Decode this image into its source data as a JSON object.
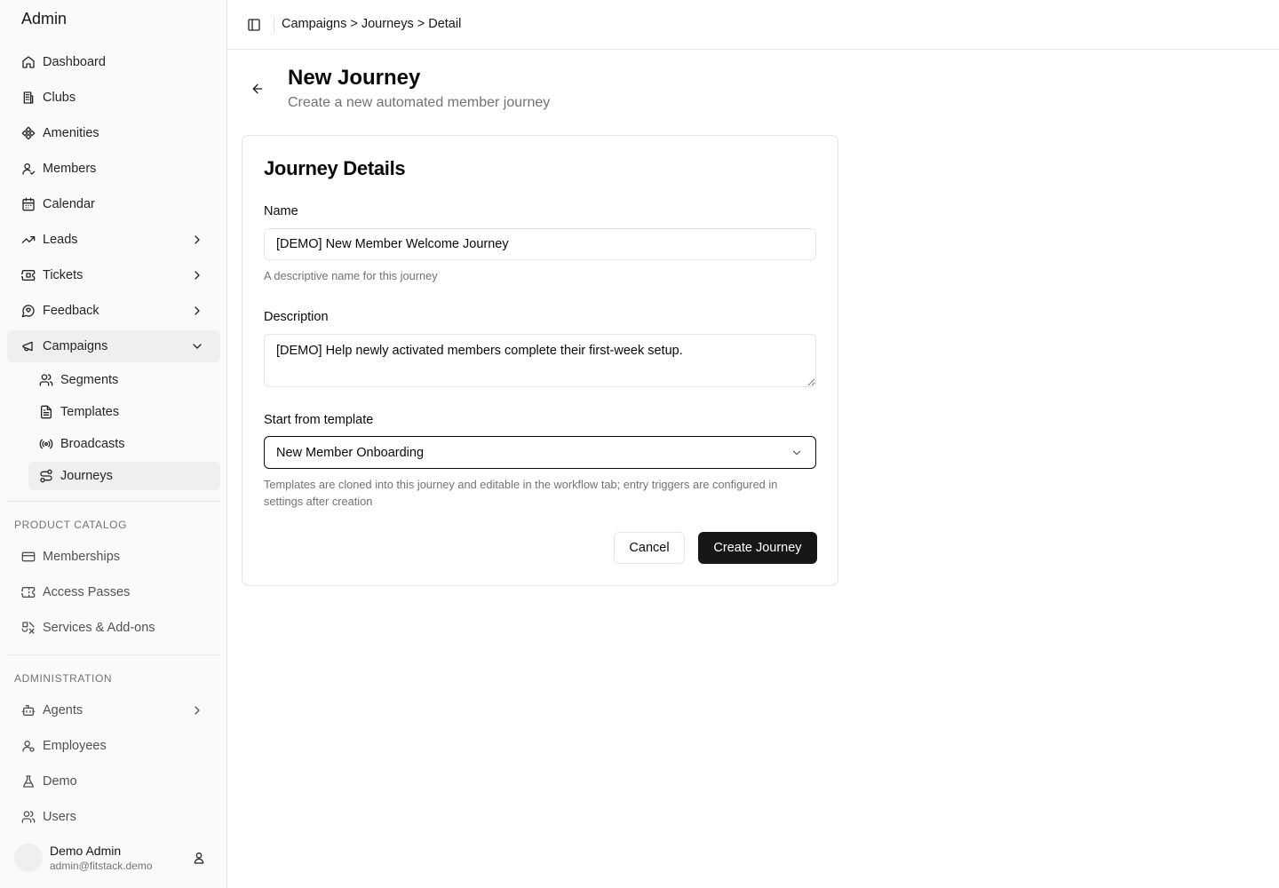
{
  "sidebar": {
    "brand": "Admin",
    "items": [
      {
        "label": "Dashboard",
        "icon": "home-icon"
      },
      {
        "label": "Clubs",
        "icon": "building-icon"
      },
      {
        "label": "Amenities",
        "icon": "amenities-icon"
      },
      {
        "label": "Members",
        "icon": "member-icon"
      },
      {
        "label": "Calendar",
        "icon": "calendar-icon"
      },
      {
        "label": "Leads",
        "icon": "trend-icon"
      },
      {
        "label": "Tickets",
        "icon": "ticket-icon"
      },
      {
        "label": "Feedback",
        "icon": "feedback-icon"
      },
      {
        "label": "Campaigns",
        "icon": "megaphone-icon"
      }
    ],
    "campaign_sub": [
      {
        "label": "Segments",
        "icon": "users-icon"
      },
      {
        "label": "Templates",
        "icon": "file-icon"
      },
      {
        "label": "Broadcasts",
        "icon": "broadcast-icon"
      },
      {
        "label": "Journeys",
        "icon": "route-icon"
      }
    ],
    "product_catalog_label": "PRODUCT CATALOG",
    "product_items": [
      {
        "label": "Memberships",
        "icon": "card-icon"
      },
      {
        "label": "Access Passes",
        "icon": "pass-icon"
      },
      {
        "label": "Services & Add-ons",
        "icon": "services-icon"
      }
    ],
    "administration_label": "ADMINISTRATION",
    "admin_items": [
      {
        "label": "Agents",
        "icon": "bot-icon"
      },
      {
        "label": "Employees",
        "icon": "employee-icon"
      },
      {
        "label": "Demo",
        "icon": "flask-icon"
      },
      {
        "label": "Users",
        "icon": "users-icon"
      }
    ],
    "user": {
      "name": "Demo Admin",
      "email": "admin@fitstack.demo"
    }
  },
  "topbar": {
    "breadcrumb": "Campaigns > Journeys > Detail"
  },
  "page": {
    "title": "New Journey",
    "subtitle": "Create a new automated member journey"
  },
  "form": {
    "card_title": "Journey Details",
    "name_label": "Name",
    "name_value": "[DEMO] New Member Welcome Journey",
    "name_help": "A descriptive name for this journey",
    "description_label": "Description",
    "description_value": "[DEMO] Help newly activated members complete their first-week setup.",
    "template_label": "Start from template",
    "template_value": "New Member Onboarding",
    "template_help": "Templates are cloned into this journey and editable in the workflow tab; entry triggers are configured in settings after creation",
    "cancel_label": "Cancel",
    "submit_label": "Create Journey"
  }
}
